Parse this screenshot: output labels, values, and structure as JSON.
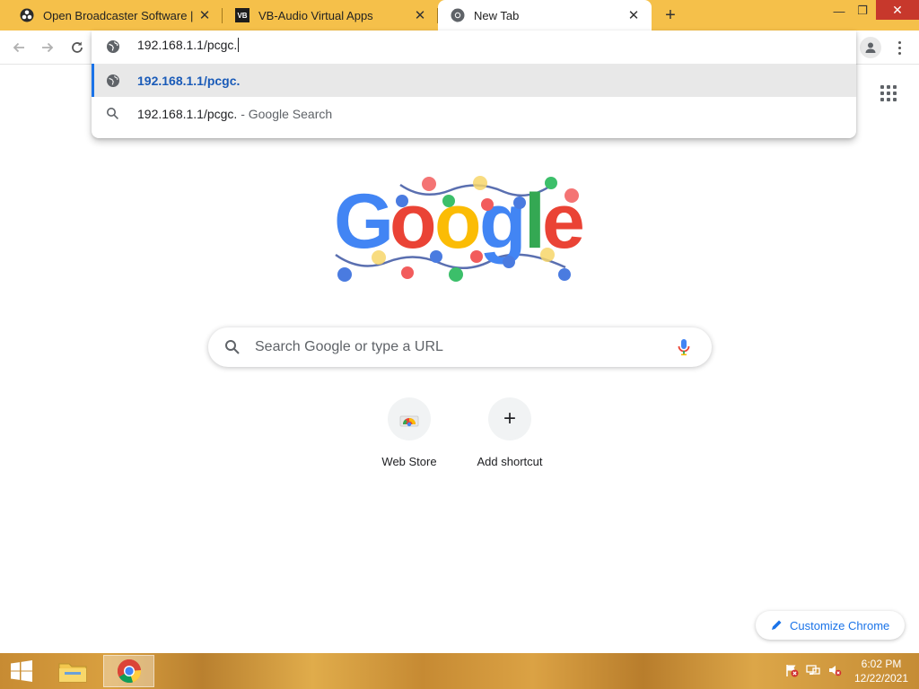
{
  "tabs": [
    {
      "title": "Open Broadcaster Software | OBS",
      "icon": "obs-icon",
      "active": false
    },
    {
      "title": "VB-Audio Virtual Apps",
      "icon": "vb-audio-icon",
      "active": false
    },
    {
      "title": "New Tab",
      "icon": "chrome-icon",
      "active": true
    }
  ],
  "tab_close_glyph": "✕",
  "new_tab_glyph": "+",
  "window_controls": {
    "minimize": "—",
    "restore": "❐",
    "close": "✕"
  },
  "omnibox": {
    "value": "192.168.1.1/pcgc.",
    "suggestions": [
      {
        "text": "192.168.1.1/pcgc.",
        "suffix": "",
        "icon": "globe-icon",
        "selected": true
      },
      {
        "text": "192.168.1.1/pcgc.",
        "suffix": " - Google Search",
        "icon": "search-icon",
        "selected": false
      }
    ]
  },
  "doodle": {
    "alt": "Google"
  },
  "search": {
    "placeholder": "Search Google or type a URL"
  },
  "shortcuts": [
    {
      "label": "Web Store",
      "icon": "web-store-icon"
    },
    {
      "label": "Add shortcut",
      "icon": "plus-icon",
      "glyph": "+"
    }
  ],
  "customize": {
    "label": "Customize Chrome"
  },
  "taskbar": {
    "time": "6:02 PM",
    "date": "12/22/2021"
  },
  "colors": {
    "accent": "#1a73e8",
    "tabstrip": "#f5c04a",
    "google_blue": "#4285f4",
    "google_red": "#ea4335",
    "google_yellow": "#fbbc05",
    "google_green": "#34a853"
  }
}
